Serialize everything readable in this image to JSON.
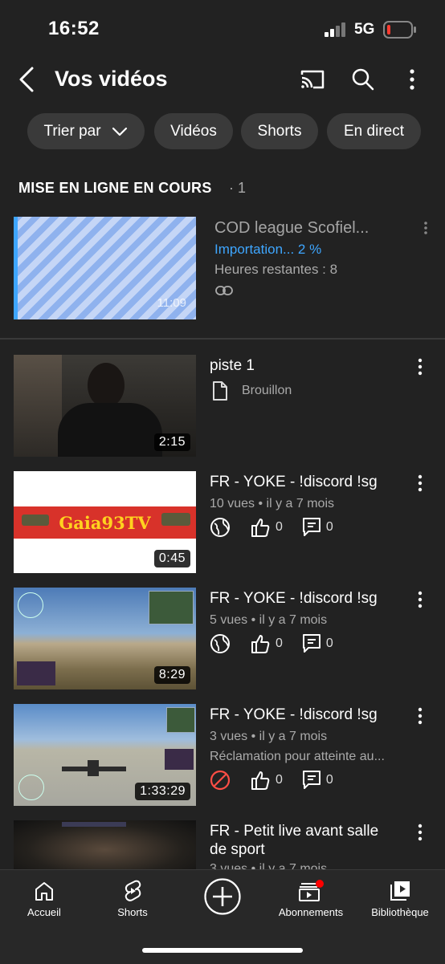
{
  "status_bar": {
    "time": "16:52",
    "network": "5G",
    "battery_color": "#ff3b30"
  },
  "header": {
    "title": "Vos vidéos",
    "icons": [
      "back-arrow-icon",
      "cast-icon",
      "search-icon",
      "more-vertical-icon"
    ]
  },
  "chips": [
    {
      "label": "Trier par"
    },
    {
      "label": "Vidéos"
    },
    {
      "label": "Shorts"
    },
    {
      "label": "En direct"
    }
  ],
  "upload_section": {
    "title": "MISE EN LIGNE EN COURS",
    "count": "· 1",
    "item": {
      "title": "COD league Scofiel...",
      "progress_text": "Importation... 2 %",
      "progress": 0.02,
      "remaining": "Heures restantes : 8",
      "duration": "11:09",
      "progress_color": "#3ea6ff"
    }
  },
  "videos": [
    {
      "title": "piste 1",
      "status": "Brouillon",
      "duration": "2:15"
    },
    {
      "title": "FR - YOKE - !discord !sg",
      "meta": "10 vues • il y a 7 mois",
      "duration": "0:45",
      "likes": "0",
      "comments": "0",
      "visibility_icon": "globe-icon",
      "thumb_banner": "Gaia93TV"
    },
    {
      "title": "FR - YOKE - !discord !sg",
      "meta": "5 vues • il y a 7 mois",
      "duration": "8:29",
      "likes": "0",
      "comments": "0",
      "visibility_icon": "globe-icon"
    },
    {
      "title": "FR - YOKE - !discord !sg",
      "meta": "3 vues • il y a 7 mois",
      "claim": "Réclamation pour atteinte au...",
      "duration": "1:33:29",
      "likes": "0",
      "comments": "0",
      "visibility_icon": "blocked-icon",
      "blocked_color": "#ff4e45"
    },
    {
      "title_line1": "FR - Petit live avant salle",
      "title_line2": "de sport",
      "meta": "3 vues • il y a 7 mois"
    }
  ],
  "bottom_nav": [
    {
      "label": "Accueil",
      "icon": "home-icon"
    },
    {
      "label": "Shorts",
      "icon": "shorts-icon"
    },
    {
      "label": "",
      "icon": "create-plus-icon"
    },
    {
      "label": "Abonnements",
      "icon": "subscriptions-icon"
    },
    {
      "label": "Bibliothèque",
      "icon": "library-icon"
    }
  ]
}
